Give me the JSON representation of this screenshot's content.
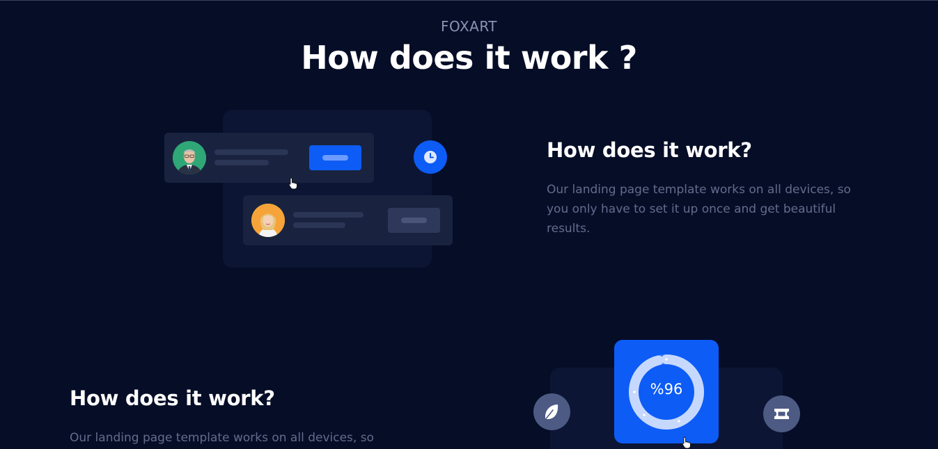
{
  "header": {
    "eyebrow": "FOXART",
    "title": "How does it work ?"
  },
  "section1": {
    "title": "How does it work?",
    "text_line1": "Our landing page template works on all devices, so",
    "text_line2": "you only have to set it up once and get beautiful",
    "text_line3": "results.",
    "illustration": {
      "avatar1": "man-avatar",
      "avatar2": "woman-avatar",
      "icon": "clock-icon"
    }
  },
  "section2": {
    "title": "How does it work?",
    "text_line1": "Our landing page template works on all devices, so",
    "stat": {
      "value": "%96",
      "progress": 0.96
    },
    "icons": [
      "feather-icon",
      "ticket-icon"
    ]
  },
  "colors": {
    "background": "#060d27",
    "accent": "#0d5cf5",
    "muted_text": "#636c8c"
  }
}
